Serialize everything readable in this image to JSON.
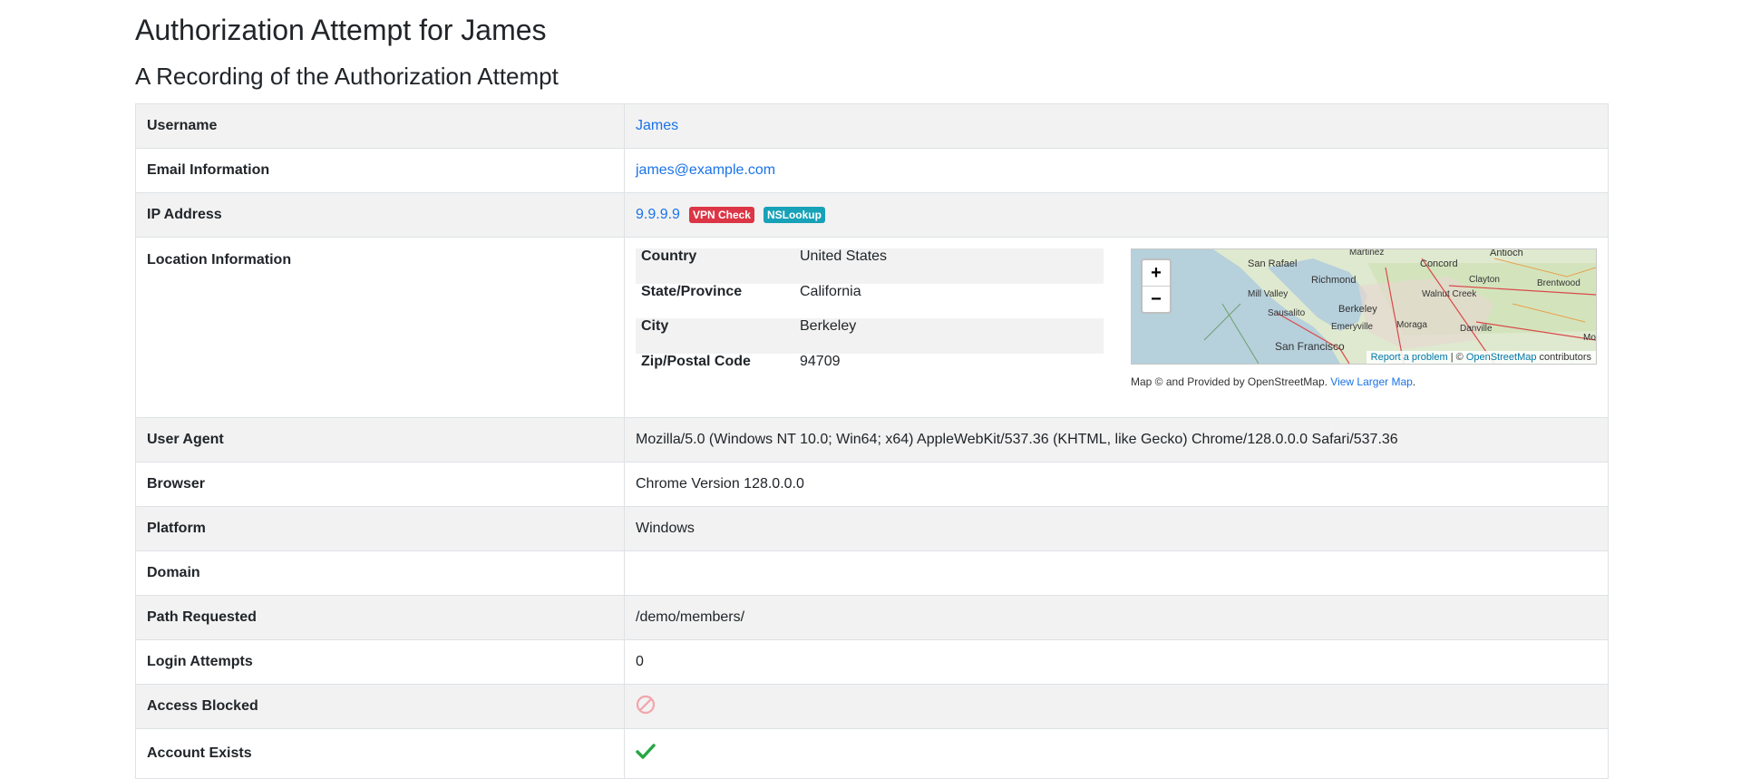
{
  "page": {
    "title": "Authorization Attempt for James",
    "subtitle": "A Recording of the Authorization Attempt"
  },
  "rows": {
    "username": {
      "label": "Username",
      "value": "James"
    },
    "email": {
      "label": "Email Information",
      "value": "james@example.com"
    },
    "ip": {
      "label": "IP Address",
      "value": "9.9.9.9",
      "vpn_badge": "VPN Check",
      "nslookup_badge": "NSLookup"
    },
    "location": {
      "label": "Location Information",
      "country_label": "Country",
      "country": "United States",
      "state_label": "State/Province",
      "state": "California",
      "city_label": "City",
      "city": "Berkeley",
      "zip_label": "Zip/Postal Code",
      "zip": "94709"
    },
    "user_agent": {
      "label": "User Agent",
      "value": "Mozilla/5.0 (Windows NT 10.0; Win64; x64) AppleWebKit/537.36 (KHTML, like Gecko) Chrome/128.0.0.0 Safari/537.36"
    },
    "browser": {
      "label": "Browser",
      "value": "Chrome Version 128.0.0.0"
    },
    "platform": {
      "label": "Platform",
      "value": "Windows"
    },
    "domain": {
      "label": "Domain",
      "value": ""
    },
    "path": {
      "label": "Path Requested",
      "value": "/demo/members/"
    },
    "login_attempts": {
      "label": "Login Attempts",
      "value": "0"
    },
    "access_blocked": {
      "label": "Access Blocked",
      "icon": "blocked-icon"
    },
    "account_exists": {
      "label": "Account Exists",
      "icon": "check-icon"
    }
  },
  "map": {
    "zoom_in": "+",
    "zoom_out": "−",
    "report_link": "Report a problem",
    "attrib_sep": " | © ",
    "osm_link": "OpenStreetMap",
    "attrib_suffix": " contributors",
    "caption_text": "Map © and Provided by OpenStreetMap. ",
    "larger_map_link": "View Larger Map",
    "caption_end": ".",
    "places": [
      "Martinez",
      "Antioch",
      "San Rafael",
      "Concord",
      "Richmond",
      "Clayton",
      "Brentwood",
      "Mill Valley",
      "Walnut Creek",
      "Sausalito",
      "Berkeley",
      "Emeryville",
      "Moraga",
      "Danville",
      "San Francisco",
      "Mo"
    ]
  },
  "colors": {
    "link": "#1a73e8",
    "badge_red": "#dc3545",
    "badge_teal": "#17a2b8",
    "check_green": "#28a745",
    "blocked_red": "#f1a5ac"
  }
}
